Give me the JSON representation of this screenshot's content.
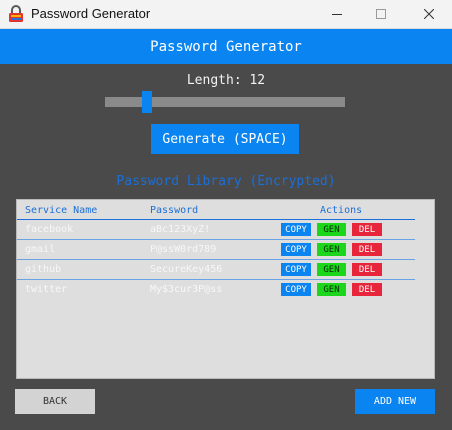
{
  "window": {
    "title": "Password Generator",
    "icon": "lock-icon",
    "controls": [
      "minimize-icon",
      "maximize-icon",
      "close-icon"
    ]
  },
  "header": {
    "title": "Password Generator"
  },
  "length": {
    "label": "Length: 12",
    "value": 12,
    "slider_fraction": 0.16
  },
  "generate_button": "Generate (SPACE)",
  "library": {
    "title": "Password Library (Encrypted)",
    "columns": [
      "Service Name",
      "Password",
      "Actions"
    ],
    "rows": [
      {
        "service": "facebook",
        "password": "aBc123XyZ!"
      },
      {
        "service": "gmail",
        "password": "P@ssW0rd789"
      },
      {
        "service": "github",
        "password": "SecureKey456"
      },
      {
        "service": "twitter",
        "password": "My$3cur3P@ss"
      }
    ],
    "actions": {
      "copy": "COPY",
      "gen": "GEN",
      "del": "DEL"
    }
  },
  "footer": {
    "back": "BACK",
    "add_new": "ADD NEW"
  },
  "colors": {
    "accent": "#0a84f0",
    "background": "#4a4a4a",
    "gen": "#1bd61b",
    "del": "#e8263b",
    "panel": "#dedede"
  }
}
